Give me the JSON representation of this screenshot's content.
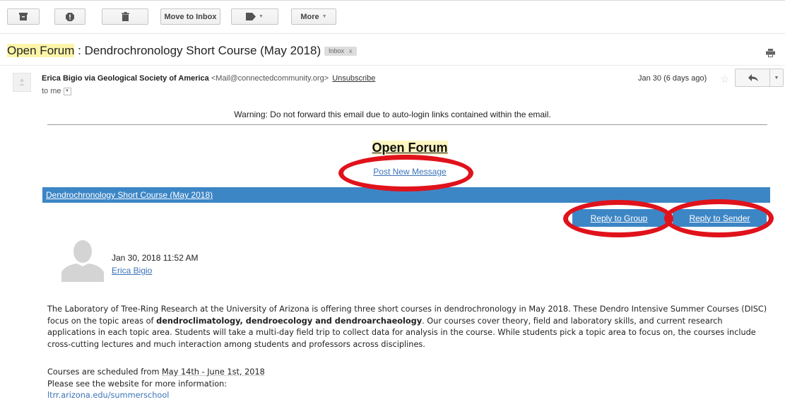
{
  "toolbar": {
    "archive_icon": "archive-icon",
    "spam_icon": "report-spam-icon",
    "delete_icon": "trash-icon",
    "move_to_inbox_label": "Move to Inbox",
    "labels_icon": "label-tag-icon",
    "more_label": "More"
  },
  "subject": {
    "forum": "Open Forum",
    "rest": " : Dendrochronology Short Course (May 2018)",
    "label": "Inbox",
    "label_close": "x"
  },
  "message": {
    "sender_name": "Erica Bigio via Geological Society of America",
    "sender_email": "<Mail@connectedcommunity.org>",
    "unsubscribe": "Unsubscribe",
    "to": "to me",
    "date": "Jan 30 (6 days ago)"
  },
  "email": {
    "warning": "Warning: Do not forward this email due to auto-login links contained within the email.",
    "forum_title": "Open Forum",
    "post_new": "Post New Message",
    "thread_title": "Dendrochronology Short Course (May 2018)",
    "reply_group": "Reply to Group",
    "reply_sender": "Reply to Sender",
    "post_date": "Jan 30, 2018 11:52 AM",
    "post_author": "Erica Bigio",
    "para1_a": "The Laboratory of Tree-Ring Research at the University of Arizona is offering three short courses in dendrochronology in May 2018.  These Dendro Intensive Summer Courses (DISC) focus on the topic areas of ",
    "para1_bold": "dendroclimatology, dendroecology and dendroarchaeology",
    "para1_b": ".  Our courses cover theory, field and laboratory skills, and current research applications in each topic area.  Students will take a multi-day field trip to collect data for analysis in the course.  While students pick a topic area to focus on, the courses include cross-cutting lectures and much interaction among students and professors across disciplines.",
    "schedule_pre": "Courses are scheduled from ",
    "schedule_dates": "May 14th - June 1st, 2018",
    "more_info": "Please see the website for more information:",
    "website": "ltrr.arizona.edu/summerschool"
  },
  "colors": {
    "accent_blue": "#3d86c6",
    "annotation_red": "#e0121b",
    "highlight_yellow": "#fcf5a8"
  }
}
